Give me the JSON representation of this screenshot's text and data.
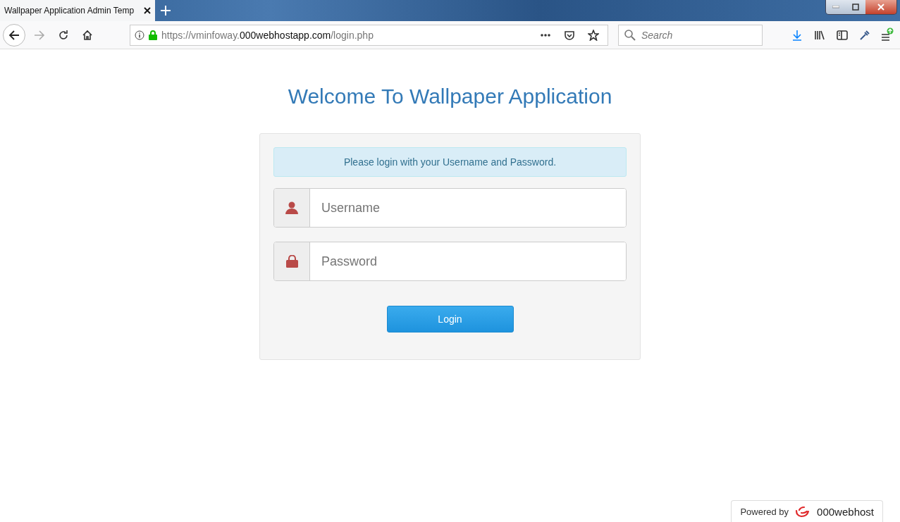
{
  "browser": {
    "tab": {
      "title": "Wallpaper Application Admin Temp",
      "selected": true
    },
    "url": {
      "scheme": "https://vminfoway.",
      "domain": "000webhostapp.com",
      "path": "/login.php"
    },
    "search": {
      "placeholder": "Search"
    }
  },
  "page": {
    "heading": "Welcome To Wallpaper Application",
    "notice": "Please login with your Username and Password.",
    "fields": [
      {
        "kind": "user",
        "placeholder": "Username"
      },
      {
        "kind": "lock",
        "placeholder": "Password"
      }
    ],
    "button": "Login"
  },
  "footer": {
    "prefix": "Powered by",
    "brand": "000webhost"
  }
}
